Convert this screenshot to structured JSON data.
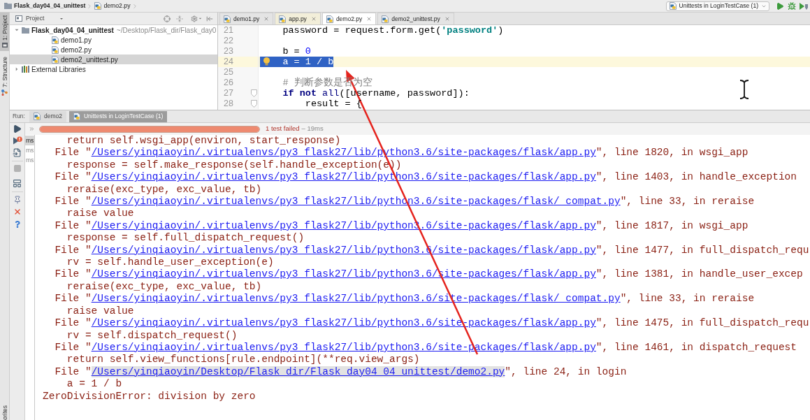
{
  "breadcrumb": [
    {
      "kind": "folder",
      "label": "Flask_day04_04_unittest"
    },
    {
      "kind": "python-file",
      "label": "demo2.py"
    }
  ],
  "run_config": {
    "label": "Unittests in LoginTestCase (1)"
  },
  "side_tabs": [
    {
      "kind": "project",
      "label": "1: Project",
      "selected": true
    },
    {
      "kind": "structure",
      "label": "7: Structure",
      "selected": false
    }
  ],
  "side_tabs_bottom": [
    {
      "label": "orites",
      "selected": false
    }
  ],
  "project_panel": {
    "title": "Project",
    "tree": [
      {
        "kind": "folder",
        "label": "Flask_day04_04_unittest",
        "path": "~/Desktop/Flask_dir/Flask_day0",
        "expanded": true,
        "selected": false,
        "children": [
          {
            "kind": "python-file",
            "label": "demo1.py",
            "selected": false
          },
          {
            "kind": "python-file",
            "label": "demo2.py",
            "selected": false
          },
          {
            "kind": "python-file",
            "label": "demo2_unittest.py",
            "selected": true
          }
        ]
      },
      {
        "kind": "library",
        "label": "External Libraries",
        "expanded": false,
        "selected": false
      }
    ]
  },
  "editor": {
    "tabs": [
      {
        "label": "demo1.py",
        "selected": false,
        "kind": "project"
      },
      {
        "label": "app.py",
        "selected": false,
        "kind": "library"
      },
      {
        "label": "demo2.py",
        "selected": true,
        "kind": "project"
      },
      {
        "label": "demo2_unittest.py",
        "selected": false,
        "kind": "project"
      }
    ],
    "lines": [
      {
        "number": "21",
        "selected": false,
        "fold": false,
        "tokens": [
          {
            "kind": "plain",
            "text": "    password = request.form.get("
          },
          {
            "kind": "string",
            "text": "'password'"
          },
          {
            "kind": "plain",
            "text": ")"
          }
        ]
      },
      {
        "number": "22",
        "selected": false,
        "fold": false
      },
      {
        "number": "23",
        "selected": false,
        "fold": false,
        "tokens": [
          {
            "kind": "plain",
            "text": "    b = "
          },
          {
            "kind": "number",
            "text": "0"
          }
        ]
      },
      {
        "number": "24",
        "selected": true,
        "fold": false,
        "tokens": [
          {
            "kind": "plain",
            "text": "    a = 1 / b"
          }
        ]
      },
      {
        "number": "25",
        "selected": false,
        "fold": false
      },
      {
        "number": "26",
        "selected": false,
        "fold": false,
        "tokens": [
          {
            "kind": "comment",
            "text": "    # 判断参数是否为空"
          }
        ]
      },
      {
        "number": "27",
        "selected": false,
        "fold": true,
        "tokens": [
          {
            "kind": "keyword",
            "text": "    if not"
          },
          {
            "kind": "builtin",
            "text": " all"
          },
          {
            "kind": "plain",
            "text": "([username, password]):"
          }
        ]
      },
      {
        "number": "28",
        "selected": false,
        "fold": true,
        "tokens": [
          {
            "kind": "plain",
            "text": "        result = {"
          }
        ]
      }
    ]
  },
  "run_panel": {
    "label": "Run:",
    "tabs": [
      {
        "label": "demo2",
        "selected": false
      },
      {
        "label": "Unittests in LoginTestCase (1)",
        "selected": true
      }
    ],
    "progress": {
      "level": 1,
      "failed": true,
      "status": "1 test failed",
      "duration": "– 19ms"
    },
    "test_tree": [
      {
        "time": "ms",
        "selected": true
      },
      {
        "time": "ms",
        "selected": false
      },
      {
        "time": "ms",
        "selected": false
      }
    ],
    "console": [
      {
        "kind": "code",
        "text": "    return self.wsgi_app(environ, start_response)"
      },
      {
        "kind": "frame",
        "prefix": "  File \"",
        "link": "/Users/yinqiaoyin/.virtualenvs/py3_flask27/lib/python3.6/site-packages/flask/app.py",
        "suffix": "\", line 1820, in wsgi_app",
        "selected": false
      },
      {
        "kind": "code",
        "text": "    response = self.make_response(self.handle_exception(e))"
      },
      {
        "kind": "frame",
        "prefix": "  File \"",
        "link": "/Users/yinqiaoyin/.virtualenvs/py3_flask27/lib/python3.6/site-packages/flask/app.py",
        "suffix": "\", line 1403, in handle_exception",
        "selected": false
      },
      {
        "kind": "code",
        "text": "    reraise(exc_type, exc_value, tb)"
      },
      {
        "kind": "frame",
        "prefix": "  File \"",
        "link": "/Users/yinqiaoyin/.virtualenvs/py3_flask27/lib/python3.6/site-packages/flask/_compat.py",
        "suffix": "\", line 33, in reraise",
        "selected": false
      },
      {
        "kind": "code",
        "text": "    raise value"
      },
      {
        "kind": "frame",
        "prefix": "  File \"",
        "link": "/Users/yinqiaoyin/.virtualenvs/py3_flask27/lib/python3.6/site-packages/flask/app.py",
        "suffix": "\", line 1817, in wsgi_app",
        "selected": false
      },
      {
        "kind": "code",
        "text": "    response = self.full_dispatch_request()"
      },
      {
        "kind": "frame",
        "prefix": "  File \"",
        "link": "/Users/yinqiaoyin/.virtualenvs/py3_flask27/lib/python3.6/site-packages/flask/app.py",
        "suffix": "\", line 1477, in full_dispatch_requ",
        "selected": false
      },
      {
        "kind": "code",
        "text": "    rv = self.handle_user_exception(e)"
      },
      {
        "kind": "frame",
        "prefix": "  File \"",
        "link": "/Users/yinqiaoyin/.virtualenvs/py3_flask27/lib/python3.6/site-packages/flask/app.py",
        "suffix": "\", line 1381, in handle_user_excep",
        "selected": false
      },
      {
        "kind": "code",
        "text": "    reraise(exc_type, exc_value, tb)"
      },
      {
        "kind": "frame",
        "prefix": "  File \"",
        "link": "/Users/yinqiaoyin/.virtualenvs/py3_flask27/lib/python3.6/site-packages/flask/_compat.py",
        "suffix": "\", line 33, in reraise",
        "selected": false
      },
      {
        "kind": "code",
        "text": "    raise value"
      },
      {
        "kind": "frame",
        "prefix": "  File \"",
        "link": "/Users/yinqiaoyin/.virtualenvs/py3_flask27/lib/python3.6/site-packages/flask/app.py",
        "suffix": "\", line 1475, in full_dispatch_requ",
        "selected": false
      },
      {
        "kind": "code",
        "text": "    rv = self.dispatch_request()"
      },
      {
        "kind": "frame",
        "prefix": "  File \"",
        "link": "/Users/yinqiaoyin/.virtualenvs/py3_flask27/lib/python3.6/site-packages/flask/app.py",
        "suffix": "\", line 1461, in dispatch_request",
        "selected": false
      },
      {
        "kind": "code",
        "text": "    return self.view_functions[rule.endpoint](**req.view_args)"
      },
      {
        "kind": "frame",
        "prefix": "  File \"",
        "link": "/Users/yinqiaoyin/Desktop/Flask_dir/Flask_day04_04_unittest/demo2.py",
        "suffix": "\", line 24, in login",
        "selected": true
      },
      {
        "kind": "code",
        "text": "    a = 1 / b"
      },
      {
        "kind": "error",
        "text": "ZeroDivisionError: division by zero"
      }
    ]
  }
}
